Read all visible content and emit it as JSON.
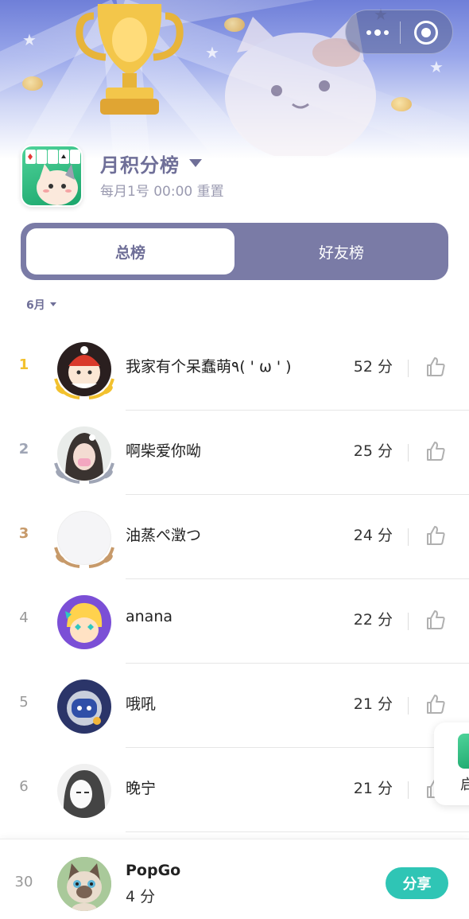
{
  "header": {
    "title": "月积分榜",
    "subtitle": "每月1号 00:00 重置"
  },
  "tabs": [
    {
      "label": "总榜",
      "active": true
    },
    {
      "label": "好友榜",
      "active": false
    }
  ],
  "month_filter": {
    "label": "6月"
  },
  "unit": "分",
  "rows": [
    {
      "rank": "1",
      "nickname": "我家有个呆蠢萌٩( ' ω ' )",
      "score": "52 分"
    },
    {
      "rank": "2",
      "nickname": "啊柴爱你呦",
      "score": "25 分"
    },
    {
      "rank": "3",
      "nickname": "油蒸ぺ澂つ",
      "score": "24 分"
    },
    {
      "rank": "4",
      "nickname": "anana",
      "score": "22 分"
    },
    {
      "rank": "5",
      "nickname": "哦吼",
      "score": "21 分"
    },
    {
      "rank": "6",
      "nickname": "晚宁",
      "score": "21 分"
    }
  ],
  "floating_card": {
    "label": "启"
  },
  "me": {
    "rank": "30",
    "nickname": "PopGo",
    "score": "4 分",
    "share_label": "分享"
  },
  "colors": {
    "accent": "#7a7ba6",
    "share": "#2fc5b5",
    "gold": "#f2c12e",
    "silver": "#9fa5b5",
    "bronze": "#c79a6a"
  },
  "icons": {
    "capsule_more": "more-dots-icon",
    "capsule_close": "capsule-close-icon",
    "like": "thumbs-up-icon",
    "dropdown": "caret-down-icon"
  }
}
